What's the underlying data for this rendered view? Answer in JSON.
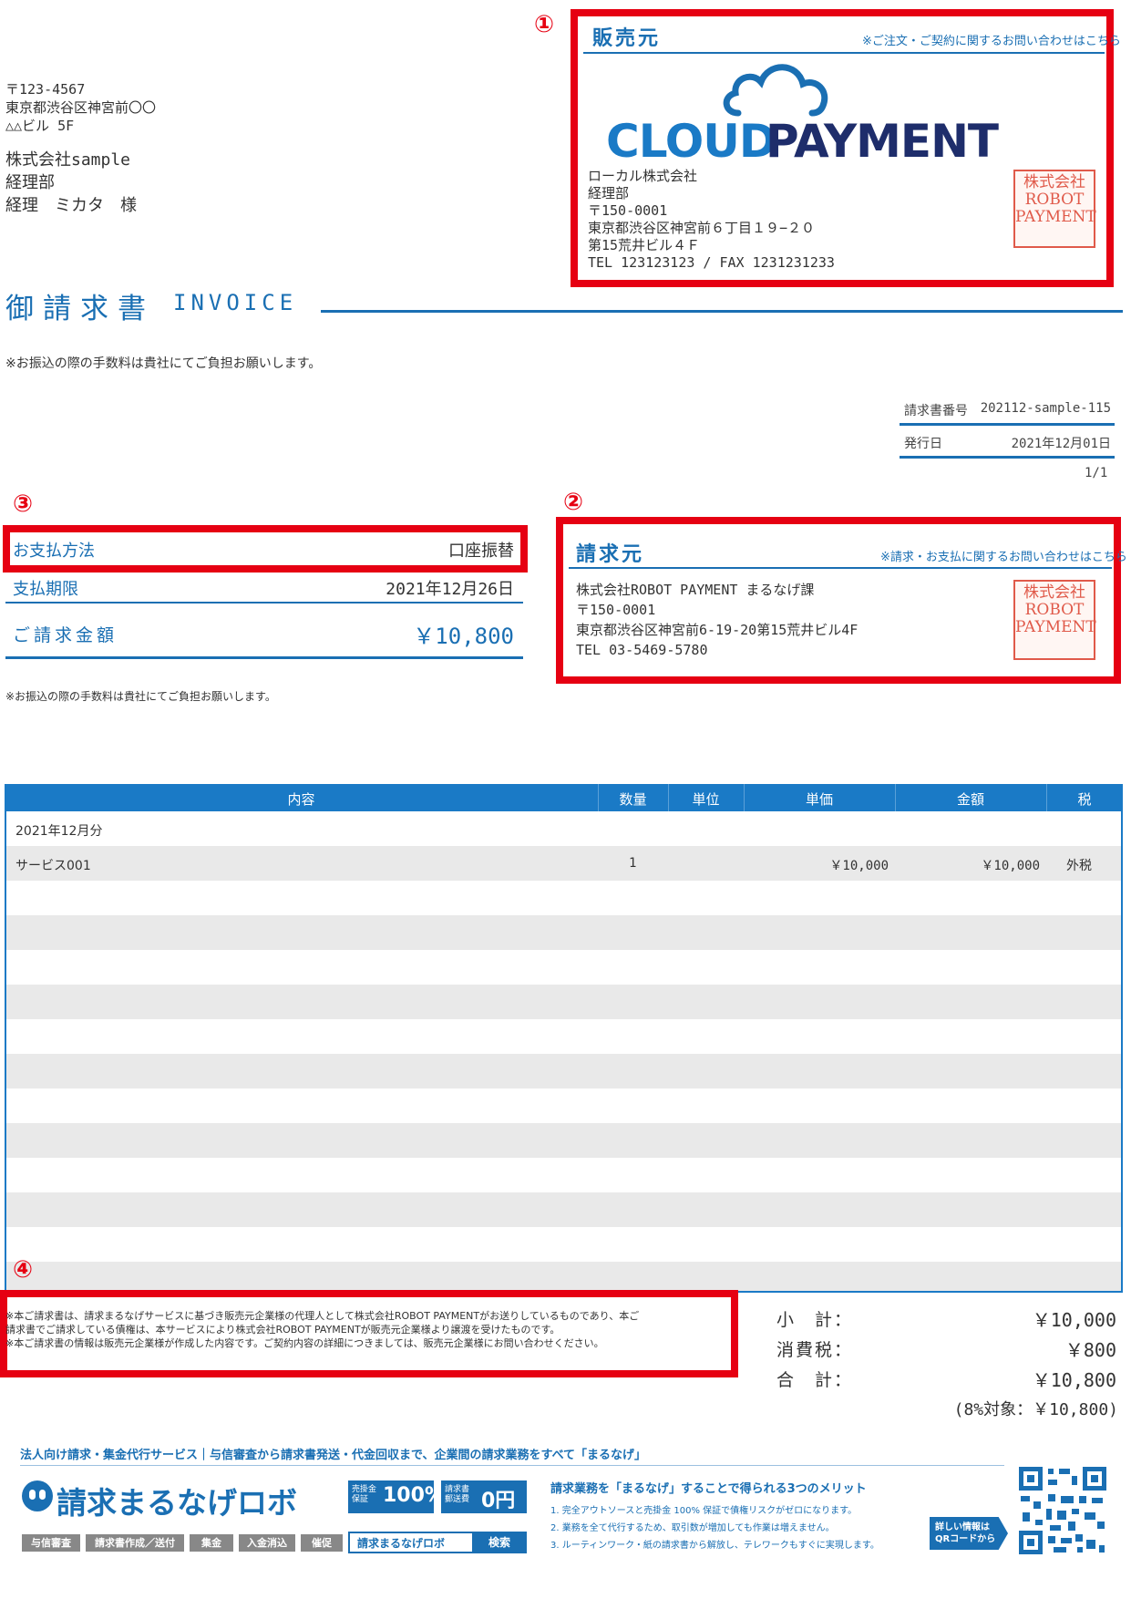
{
  "markers": {
    "m1": "①",
    "m2": "②",
    "m3": "③",
    "m4": "④"
  },
  "recipient": {
    "postal": "〒123-4567",
    "address1": "東京都渋谷区神宮前〇〇",
    "address2": "△△ビル 5F",
    "company": "株式会社sample",
    "department": "経理部",
    "person": "経理　ミカタ　様"
  },
  "seller": {
    "heading": "販売元",
    "note": "※ご注文・ご契約に関するお問い合わせはこちら",
    "logo_cloud": "CLOUD",
    "logo_payment": "PAYMENT",
    "company": "ローカル株式会社",
    "department": "経理部",
    "postal": "〒150-0001",
    "address1": "東京都渋谷区神宮前６丁目１９−２０",
    "address2": "第15荒井ビル４Ｆ",
    "tel_fax": "TEL 123123123 / FAX 1231231233",
    "stamp_lines": [
      "株式会社",
      "ROBOT",
      "PAYMENT"
    ]
  },
  "title": {
    "jp": "御請求書",
    "en": "INVOICE"
  },
  "notice_top": "※お振込の際の手数料は貴社にてご負担お願いします。",
  "meta": {
    "invoice_no_label": "請求書番号",
    "invoice_no": "202112-sample-115",
    "issue_label": "発行日",
    "issue_date": "2021年12月01日",
    "page": "1/1"
  },
  "payment": {
    "method_label": "お支払方法",
    "method": "口座振替",
    "due_label": "支払期限",
    "due": "2021年12月26日",
    "amount_label": "ご請求金額",
    "amount": "￥10,800"
  },
  "notice_small": "※お振込の際の手数料は貴社にてご負担お願いします。",
  "biller": {
    "heading": "請求元",
    "note": "※請求・お支払に関するお問い合わせはこちら",
    "company": "株式会社ROBOT PAYMENT まるなげ課",
    "postal": "〒150-0001",
    "address": "東京都渋谷区神宮前6-19-20第15荒井ビル4F",
    "tel": "TEL 03-5469-5780",
    "stamp_lines": [
      "株式会社",
      "ROBOT",
      "PAYMENT"
    ]
  },
  "table": {
    "headers": {
      "content": "内容",
      "qty": "数量",
      "unit": "単位",
      "price": "単価",
      "amount": "金額",
      "tax": "税"
    },
    "period": "2021年12月分",
    "item": {
      "name": "サービス001",
      "qty": "1",
      "price": "￥10,000",
      "amount": "￥10,000",
      "tax": "外税"
    }
  },
  "disclaimer": {
    "line1": "※本ご請求書は、請求まるなげサービスに基づき販売元企業様の代理人として株式会社ROBOT PAYMENTがお送りしているものであり、本ご",
    "line2": "請求書でご請求している債権は、本サービスにより株式会社ROBOT PAYMENTが販売元企業様より譲渡を受けたものです。",
    "line3": "※本ご請求書の情報は販売元企業様が作成した内容です。ご契約内容の詳細につきましては、販売元企業様にお問い合わせください。"
  },
  "totals": {
    "subtotal_label": "小　計：",
    "subtotal": "￥10,000",
    "tax_label": "消費税：",
    "tax": "￥800",
    "total_label": "合　計：",
    "total": "￥10,800",
    "tax_target": "(8%対象：￥10,800)"
  },
  "banner": {
    "tagline": "法人向け請求・集金代行サービス｜与信審査から請求書発送・代金回収まで、企業間の請求業務をすべて「まるなげ」",
    "brand": "請求まるなげロボ",
    "badge1_small": "売掛金保証",
    "badge1_value": "100%",
    "badge2_small": "請求書郵送費",
    "badge2_value": "0円",
    "chips": [
      "与信審査",
      "請求書作成／送付",
      "集金",
      "入金消込",
      "催促"
    ],
    "search_text": "請求まるなげロボ",
    "search_button": "検索",
    "merits_title": "請求業務を「まるなげ」することで得られる3つのメリット",
    "merit1": "1. 完全アウトソースと売掛金 100% 保証で債権リスクがゼロになります。",
    "merit2": "2. 業務を全て代行するため、取引数が増加しても作業は増えません。",
    "merit3": "3. ルーティンワーク・紙の請求書から解放し、テレワークもすぐに実現します。",
    "qr_note": "詳しい情報は QRコードから"
  }
}
